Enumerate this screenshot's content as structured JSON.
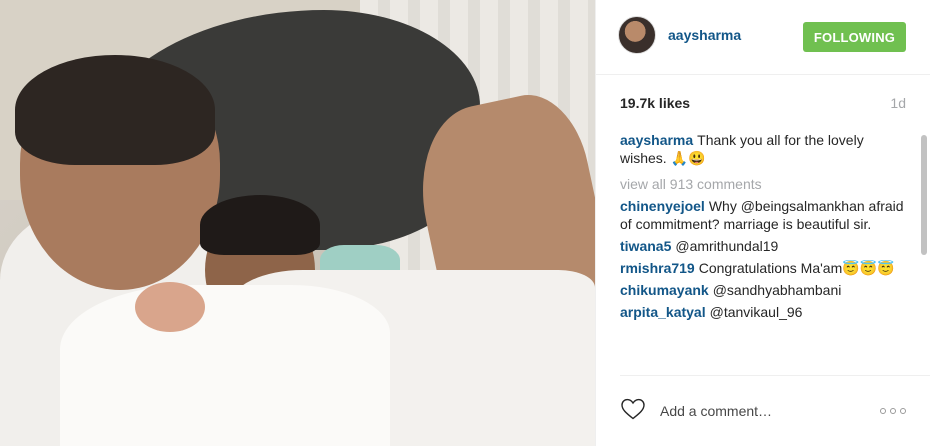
{
  "post": {
    "image_alt": "Photo"
  },
  "header": {
    "username": "aaysharma",
    "follow_label": "FOLLOWING"
  },
  "meta": {
    "likes": "19.7k likes",
    "time": "1d"
  },
  "caption": {
    "user": "aaysharma",
    "text": "Thank you all for the lovely wishes. 🙏😃"
  },
  "view_all": "view all 913 comments",
  "comments": [
    {
      "user": "chinenyejoel",
      "text": "Why @beingsalmankhan afraid of commitment? marriage is beautiful sir."
    },
    {
      "user": "tiwana5",
      "text": "@amrithundal19"
    },
    {
      "user": "rmishra719",
      "text": "Congratulations Ma'am😇😇😇"
    },
    {
      "user": "chikumayank",
      "text": "@sandhyabhambani"
    },
    {
      "user": "arpita_katyal",
      "text": "@tanvikaul_96"
    }
  ],
  "footer": {
    "placeholder": "Add a comment…"
  },
  "colors": {
    "username_blue": "#125688",
    "follow_green": "#70c050",
    "muted_gray": "#a5a7aa"
  },
  "icons": [
    "heart-icon",
    "more-options-icon"
  ]
}
